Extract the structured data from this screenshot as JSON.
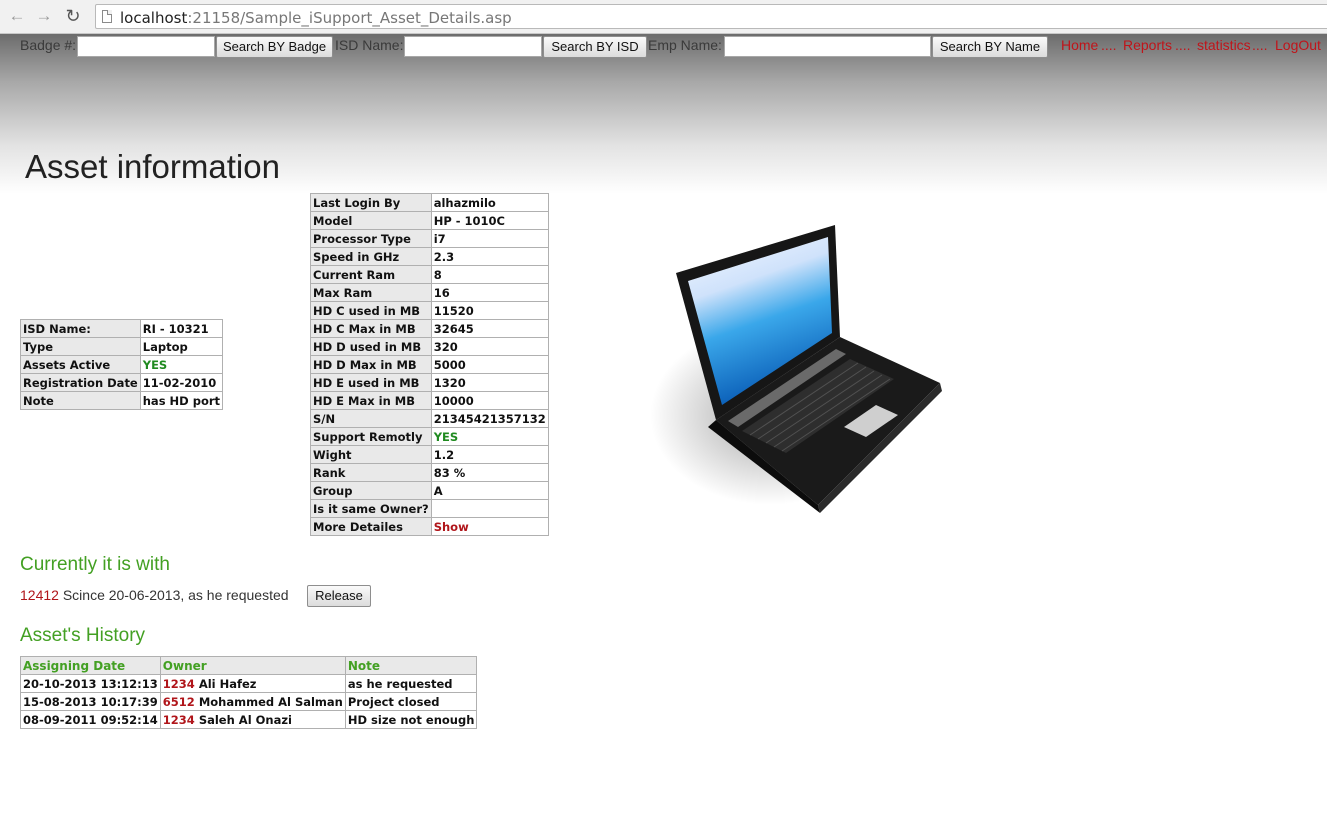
{
  "browser": {
    "url_host": "localhost",
    "url_rest": ":21158/Sample_iSupport_Asset_Details.asp"
  },
  "header": {
    "badge_label": "Badge #:",
    "badge_button": "Search BY Badge",
    "isd_label": "ISD Name:",
    "isd_button": "Search BY ISD",
    "emp_label": "Emp Name:",
    "emp_button": "Search BY Name",
    "nav": [
      "Home",
      "Reports",
      "statistics",
      "LogOut"
    ],
    "nav_separator": "....",
    "link_color": "#c0141a"
  },
  "title": "Asset information",
  "summary": [
    {
      "key": "ISD Name:",
      "value": "RI - 10321"
    },
    {
      "key": "Type",
      "value": "Laptop"
    },
    {
      "key": "Assets Active",
      "value": "YES"
    },
    {
      "key": "Registration Date",
      "value": "11-02-2010"
    },
    {
      "key": "Note",
      "value": "has HD port"
    }
  ],
  "specs": [
    {
      "key": "Last Login By",
      "value": "alhazmilo"
    },
    {
      "key": "Model",
      "value": "HP - 1010C"
    },
    {
      "key": "Processor Type",
      "value": "i7"
    },
    {
      "key": "Speed in GHz",
      "value": "2.3"
    },
    {
      "key": "Current Ram",
      "value": "8"
    },
    {
      "key": "Max Ram",
      "value": "16"
    },
    {
      "key": "HD C used in MB",
      "value": "11520"
    },
    {
      "key": "HD C Max in MB",
      "value": "32645"
    },
    {
      "key": "HD D used in MB",
      "value": "320"
    },
    {
      "key": "HD D Max in MB",
      "value": "5000"
    },
    {
      "key": "HD E used in MB",
      "value": "1320"
    },
    {
      "key": "HD E Max in MB",
      "value": "10000"
    },
    {
      "key": "S/N",
      "value": "21345421357132"
    },
    {
      "key": "Support Remotly",
      "value": "YES"
    },
    {
      "key": "Wight",
      "value": "1.2"
    },
    {
      "key": "Rank",
      "value": "83 %"
    },
    {
      "key": "Group",
      "value": "A"
    },
    {
      "key": "Is it same Owner?",
      "value": ""
    },
    {
      "key": "More Detailes",
      "value": "Show"
    }
  ],
  "image": {
    "icon": "laptop-icon"
  },
  "current": {
    "heading": "Currently it is with",
    "badge": "12412",
    "text": "Scince 20-06-2013, as he requested",
    "button": "Release"
  },
  "history": {
    "heading": "Asset's History",
    "columns": [
      "Assigning Date",
      "Owner",
      "Note"
    ],
    "rows": [
      {
        "date": "20-10-2013 13:12:13",
        "badge": "1234",
        "name": "Ali Hafez",
        "note": "as he requested"
      },
      {
        "date": "15-08-2013 10:17:39",
        "badge": "6512",
        "name": "Mohammed Al Salman",
        "note": "Project closed"
      },
      {
        "date": "08-09-2011 09:52:14",
        "badge": "1234",
        "name": "Saleh Al Onazi",
        "note": "HD size not enough"
      }
    ]
  },
  "colors": {
    "heading_green": "#43a023",
    "yes_green": "#1f8a1f",
    "badge_red": "#b0151a"
  }
}
